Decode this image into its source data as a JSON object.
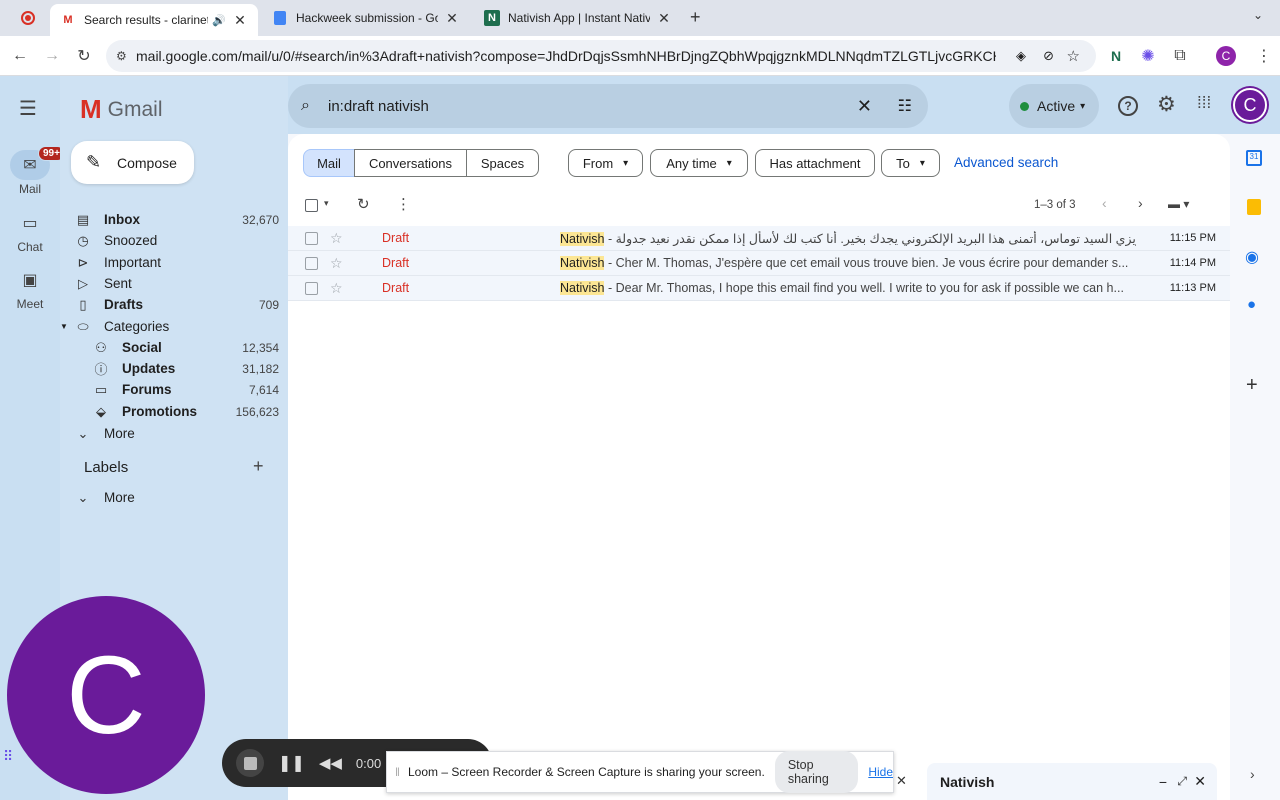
{
  "browser": {
    "tabs": [
      {
        "title": "Search results - clarinette",
        "favicon": "gmail-icon"
      },
      {
        "title": "Hackweek submission - Goog",
        "favicon": "docs-icon"
      },
      {
        "title": "Nativish App | Instant Native-",
        "favicon": "nativish-icon"
      }
    ],
    "url": "mail.google.com/mail/u/0/#search/in%3Adraft+nativish?compose=JhdDrDqjsSsmhNHBrDjngZQbhWpqjgznkMDLNNqdmTZLGTLjvcGRKCHZQpqF...",
    "profile_initial": "C",
    "ext_n": "N"
  },
  "rail": {
    "mail_label": "Mail",
    "mail_badge": "99+",
    "chat_label": "Chat",
    "meet_label": "Meet"
  },
  "gmail": {
    "logo_text": "Gmail",
    "compose_label": "Compose",
    "search_query": "in:draft nativish",
    "status_label": "Active",
    "avatar_initial": "C",
    "nav": [
      {
        "label": "Inbox",
        "count": "32,670",
        "icon": "inbox-icon"
      },
      {
        "label": "Snoozed",
        "count": "",
        "icon": "clock-icon"
      },
      {
        "label": "Important",
        "count": "",
        "icon": "important-icon"
      },
      {
        "label": "Sent",
        "count": "",
        "icon": "send-icon"
      },
      {
        "label": "Drafts",
        "count": "709",
        "icon": "draft-icon"
      },
      {
        "label": "Categories",
        "count": "",
        "icon": "label-icon"
      },
      {
        "label": "Social",
        "count": "12,354",
        "icon": "people-icon"
      },
      {
        "label": "Updates",
        "count": "31,182",
        "icon": "info-icon"
      },
      {
        "label": "Forums",
        "count": "7,614",
        "icon": "forum-icon"
      },
      {
        "label": "Promotions",
        "count": "156,623",
        "icon": "tag-icon"
      },
      {
        "label": "More",
        "count": "",
        "icon": "chevron-down-icon"
      }
    ],
    "labels_heading": "Labels",
    "labels_more": "More",
    "filters": {
      "tabs": [
        "Mail",
        "Conversations",
        "Spaces"
      ],
      "from": "From",
      "any_time": "Any time",
      "has_attachment": "Has attachment",
      "to": "To",
      "advanced": "Advanced search"
    },
    "pagination": "1–3 of 3",
    "rows": [
      {
        "label": "Draft",
        "sender": "Nativish",
        "snippet": "- عزيزي السيد توماس، أتمنى هذا البريد الإلكتروني يجدك بخير. أنا كتب لك لأسأل إذا ممكن نقدر نعيد جدولة",
        "time": "11:15 PM"
      },
      {
        "label": "Draft",
        "sender": "Nativish",
        "snippet": "- Cher M. Thomas, J'espère que cet email vous trouve bien. Je vous écrire pour demander s...",
        "time": "11:14 PM"
      },
      {
        "label": "Draft",
        "sender": "Nativish",
        "snippet": "- Dear Mr. Thomas, I hope this email find you well. I write to you for ask if possible we can h...",
        "time": "11:13 PM"
      }
    ]
  },
  "overlay": {
    "loom_avatar_initial": "C",
    "timer": "0:00",
    "sharing_text": "Loom – Screen Recorder & Screen Capture is sharing your screen.",
    "stop_sharing": "Stop sharing",
    "hide": "Hide",
    "compose_title": "Nativish"
  },
  "colors": {
    "accent": "#0b57d0",
    "draft_red": "#d93025",
    "active_green": "#1e8e3e",
    "avatar_purple": "#6a1b9a"
  }
}
